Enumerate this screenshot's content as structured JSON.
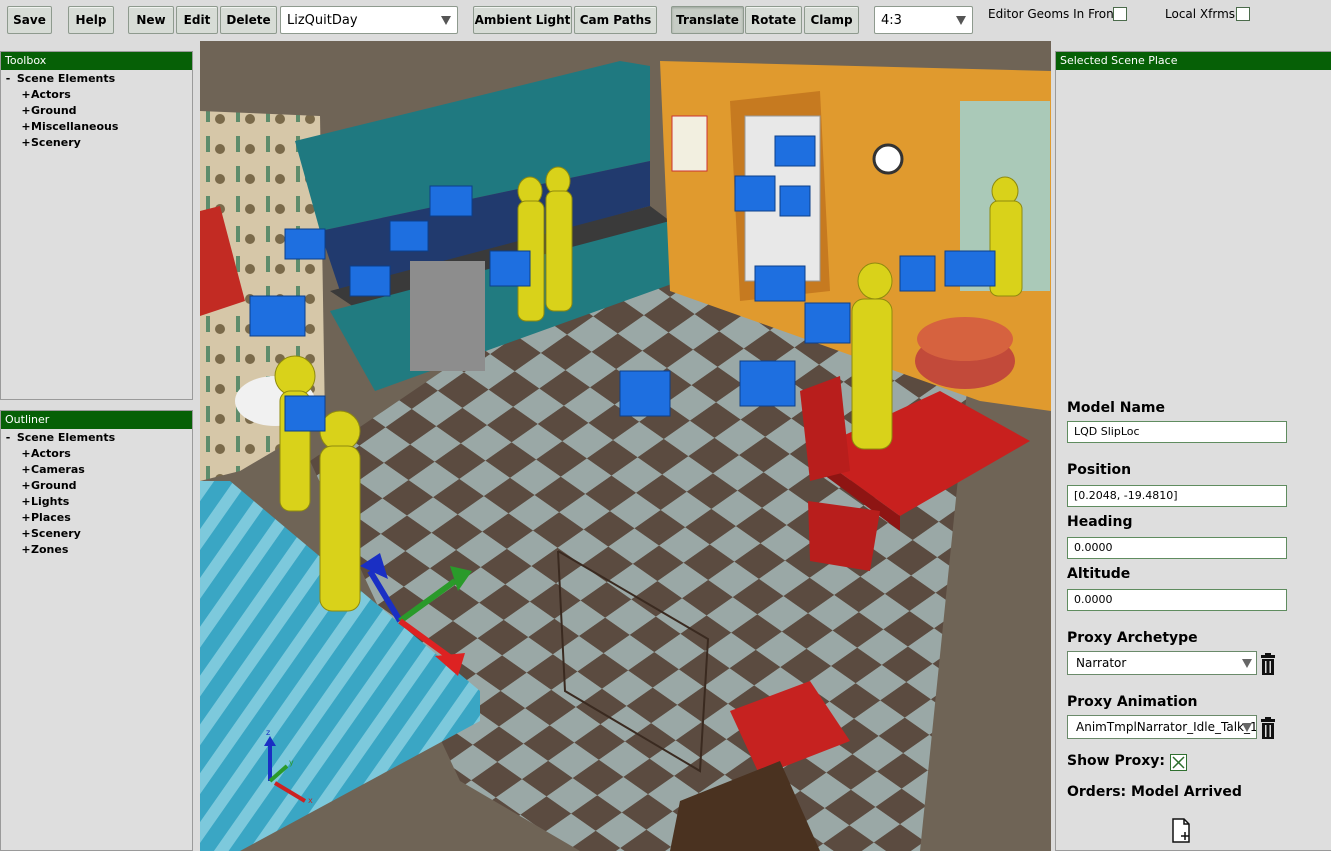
{
  "toolbar": {
    "save": "Save",
    "help": "Help",
    "new": "New",
    "edit": "Edit",
    "delete": "Delete",
    "scene_select": "LizQuitDay",
    "ambient_light": "Ambient Light",
    "cam_paths": "Cam Paths",
    "translate": "Translate",
    "rotate": "Rotate",
    "clamp": "Clamp",
    "aspect_select": "4:3",
    "editor_geoms_label": "Editor Geoms In Front:",
    "local_xfrms_label": "Local Xfrms:"
  },
  "toolbox": {
    "title": "Toolbox",
    "root": "Scene Elements",
    "items": [
      "Actors",
      "Ground",
      "Miscellaneous",
      "Scenery"
    ]
  },
  "outliner": {
    "title": "Outliner",
    "root": "Scene Elements",
    "items": [
      "Actors",
      "Cameras",
      "Ground",
      "Lights",
      "Places",
      "Scenery",
      "Zones"
    ]
  },
  "right_panel": {
    "title": "Selected Scene Place",
    "model_name_label": "Model Name",
    "model_name_value": "LQD SlipLoc",
    "position_label": "Position",
    "position_value": "[0.2048, -19.4810]",
    "heading_label": "Heading",
    "heading_value": "0.0000",
    "altitude_label": "Altitude",
    "altitude_value": "0.0000",
    "proxy_archetype_label": "Proxy Archetype",
    "proxy_archetype_value": "Narrator",
    "proxy_animation_label": "Proxy Animation",
    "proxy_animation_value": "AnimTmplNarrator_Idle_Talk_1",
    "show_proxy_label": "Show Proxy:",
    "orders_label": "Orders: Model Arrived"
  },
  "viewport": {
    "axis_labels": [
      "z",
      "y",
      "x"
    ]
  },
  "colors": {
    "header_green": "#066006",
    "proxy_yellow": "#d9d21a",
    "marker_blue": "#1e6fe0",
    "table_red": "#c8201e"
  }
}
